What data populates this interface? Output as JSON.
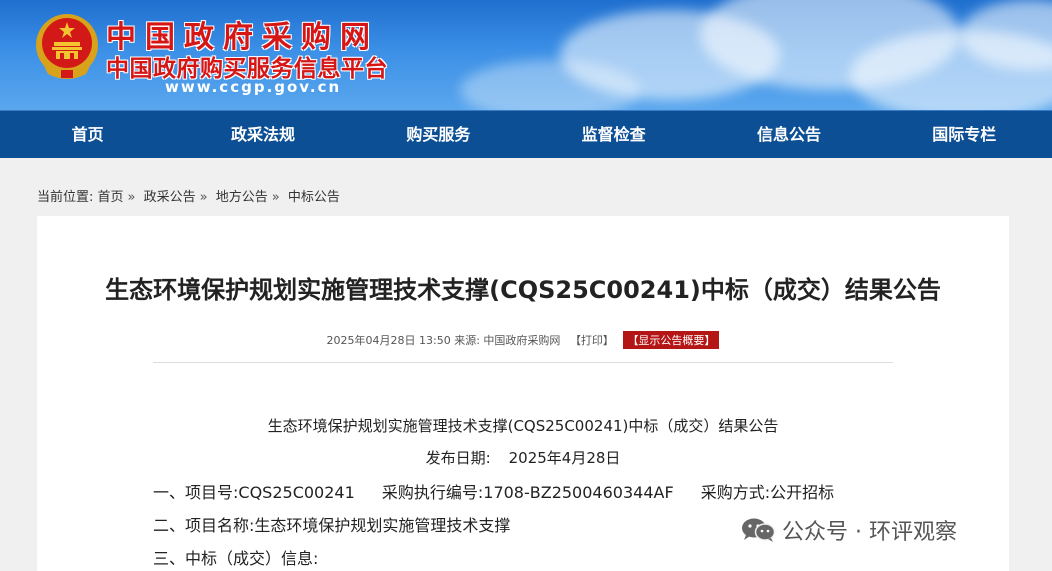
{
  "site": {
    "title": "中国政府采购网",
    "subtitle": "中国政府购买服务信息平台",
    "url": "www.ccgp.gov.cn"
  },
  "nav": [
    {
      "label": "首页"
    },
    {
      "label": "政采法规"
    },
    {
      "label": "购买服务"
    },
    {
      "label": "监督检查"
    },
    {
      "label": "信息公告"
    },
    {
      "label": "国际专栏"
    }
  ],
  "breadcrumb": {
    "prefix": "当前位置:",
    "items": [
      "首页",
      "政采公告",
      "地方公告",
      "中标公告"
    ],
    "separator": "»"
  },
  "article": {
    "title": "生态环境保护规划实施管理技术支撑(CQS25C00241)中标（成交）结果公告",
    "meta_date": "2025年04月28日 13:50",
    "meta_source": "来源: 中国政府采购网",
    "print_label": "【打印】",
    "summary_label": "【显示公告概要】",
    "body_title": "生态环境保护规划实施管理技术支撑(CQS25C00241)中标（成交）结果公告",
    "pub_date_label": "发布日期:",
    "pub_date_value": "2025年4月28日",
    "line1": {
      "item_no_label": "一、项目号:",
      "item_no": "CQS25C00241",
      "exec_no_label": "采购执行编号:",
      "exec_no": "1708-BZ2500460344AF",
      "method_label": "采购方式:",
      "method": "公开招标"
    },
    "line2": {
      "label": "二、项目名称:",
      "value": "生态环境保护规划实施管理技术支撑"
    },
    "line3": {
      "label": "三、中标（成交）信息:"
    }
  },
  "watermark": {
    "text": "公众号 · 环评观察"
  },
  "colors": {
    "nav_bg": "#0d4f95",
    "title_red": "#d61515",
    "summary_badge": "#b41515"
  }
}
